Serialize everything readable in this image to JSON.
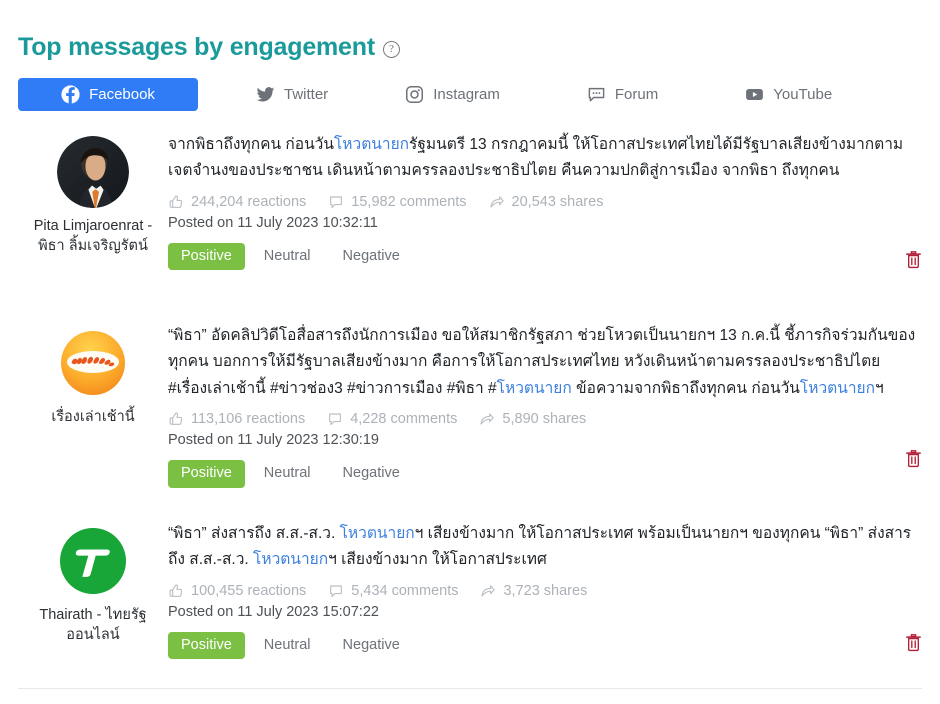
{
  "header": {
    "title": "Top messages by engagement",
    "help_icon": "question-circle-icon"
  },
  "tabs": [
    {
      "id": "facebook",
      "label": "Facebook",
      "icon": "facebook-icon",
      "active": true,
      "accent": "#2f7cf6"
    },
    {
      "id": "twitter",
      "label": "Twitter",
      "icon": "twitter-icon",
      "active": false,
      "accent": "#6d7278"
    },
    {
      "id": "instagram",
      "label": "Instagram",
      "icon": "instagram-icon",
      "active": false,
      "accent": "#6d7278"
    },
    {
      "id": "forum",
      "label": "Forum",
      "icon": "forum-icon",
      "active": false,
      "accent": "#6d7278"
    },
    {
      "id": "youtube",
      "label": "YouTube",
      "icon": "youtube-icon",
      "active": false,
      "accent": "#6d7278"
    }
  ],
  "sentiment_options": [
    "Positive",
    "Neutral",
    "Negative"
  ],
  "colors": {
    "title": "#1a9a9a",
    "active_tab_bg": "#2f7cf6",
    "positive_chip": "#7bc043",
    "link": "#3b7fe0",
    "trash": "#b01e38"
  },
  "posts": [
    {
      "author": "Pita Limjaroenrat - พิธา ลิ้มเจริญรัตน์",
      "avatar_icon": "avatar-photo-pita",
      "text_parts": [
        {
          "t": "จากพิธาถึงทุกคน ก่อนวัน",
          "hl": false
        },
        {
          "t": "โหวตนายก",
          "hl": true
        },
        {
          "t": "รัฐมนตรี 13 กรกฎาคมนี้ ให้โอกาสประเทศไทยได้มีรัฐบาลเสียงข้างมากตามเจตจำนงของประชาชน เดินหน้าตามครรลองประชาธิปไตย คืนความปกติสู่การเมือง จากพิธา ถึงทุกคน",
          "hl": false
        }
      ],
      "reactions": "244,204 reactions",
      "comments": "15,982 comments",
      "shares": "20,543 shares",
      "posted": "Posted on 11 July 2023 10:32:11",
      "selected_sentiment": "Positive",
      "delete_icon": "trash-icon"
    },
    {
      "author": "เรื่องเล่าเช้านี้",
      "avatar_icon": "avatar-logo-ruengleacownee",
      "text_parts": [
        {
          "t": "“พิธา” อัดคลิปวิดีโอสื่อสารถึงนักการเมือง ขอให้สมาชิกรัฐสภา ช่วยโหวตเป็นนายกฯ 13 ก.ค.นี้ ชี้ภารกิจร่วมกันของทุกคน บอกการให้มีรัฐบาลเสียงข้างมาก คือการให้โอกาสประเทศไทย หวังเดินหน้าตามครรลองประชาธิปไตย #เรื่องเล่าเช้านี้ #ข่าวช่อง3 #ข่าวการเมือง #พิธา #",
          "hl": false
        },
        {
          "t": "โหวตนายก",
          "hl": true
        },
        {
          "t": " ข้อความจากพิธาถึงทุกคน ก่อนวัน",
          "hl": false
        },
        {
          "t": "โหวตนายก",
          "hl": true
        },
        {
          "t": "ฯ",
          "hl": false
        }
      ],
      "reactions": "113,106 reactions",
      "comments": "4,228 comments",
      "shares": "5,890 shares",
      "posted": "Posted on 11 July 2023 12:30:19",
      "selected_sentiment": "Positive",
      "delete_icon": "trash-icon"
    },
    {
      "author": "Thairath - ไทยรัฐออนไลน์",
      "avatar_icon": "avatar-logo-thairath",
      "text_parts": [
        {
          "t": "“พิธา” ส่งสารถึง ส.ส.-ส.ว. ",
          "hl": false
        },
        {
          "t": "โหวตนายก",
          "hl": true
        },
        {
          "t": "ฯ เสียงข้างมาก ให้โอกาสประเทศ พร้อมเป็นนายกฯ ของทุกคน “พิธา” ส่งสารถึง ส.ส.-ส.ว. ",
          "hl": false
        },
        {
          "t": "โหวตนายก",
          "hl": true
        },
        {
          "t": "ฯ เสียงข้างมาก ให้โอกาสประเทศ",
          "hl": false
        }
      ],
      "reactions": "100,455 reactions",
      "comments": "5,434 comments",
      "shares": "3,723 shares",
      "posted": "Posted on 11 July 2023 15:07:22",
      "selected_sentiment": "Positive",
      "delete_icon": "trash-icon"
    }
  ]
}
